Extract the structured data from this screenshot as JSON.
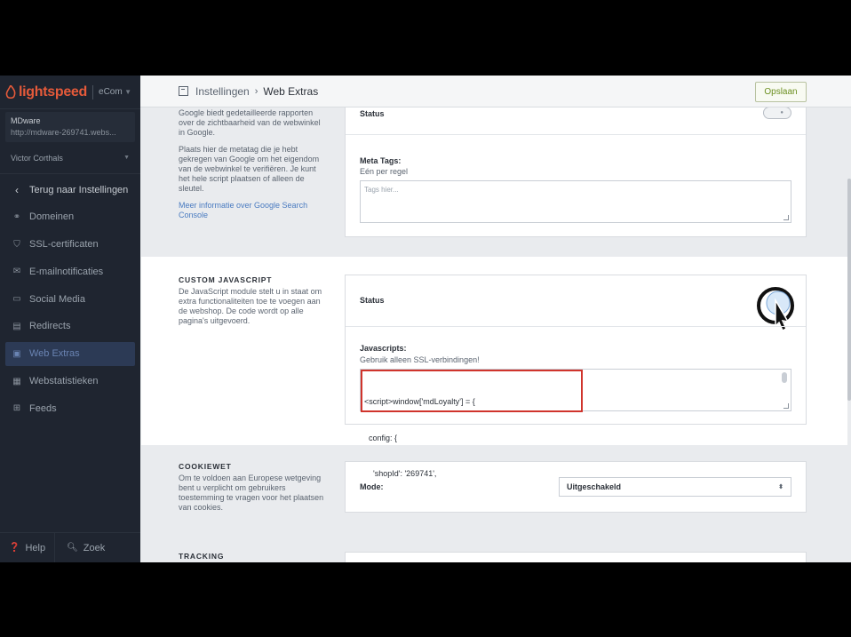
{
  "sidebar": {
    "logo_text": "lightspeed",
    "logo_product": "eCom",
    "store": {
      "name": "MDware",
      "url": "http://mdware-269741.webs..."
    },
    "user": "Victor Corthals",
    "back_label": "Terug naar Instellingen",
    "items": [
      {
        "label": "Domeinen",
        "icon": "link-icon"
      },
      {
        "label": "SSL-certificaten",
        "icon": "shield-icon"
      },
      {
        "label": "E-mailnotificaties",
        "icon": "mail-icon"
      },
      {
        "label": "Social Media",
        "icon": "chat-icon"
      },
      {
        "label": "Redirects",
        "icon": "redirect-icon"
      },
      {
        "label": "Web Extras",
        "icon": "web-extras-icon"
      },
      {
        "label": "Webstatistieken",
        "icon": "stats-icon"
      },
      {
        "label": "Feeds",
        "icon": "feeds-icon"
      }
    ],
    "help_label": "Help",
    "search_label": "Zoek"
  },
  "topbar": {
    "crumb_parent": "Instellingen",
    "crumb_separator": "›",
    "crumb_current": "Web Extras",
    "save_label": "Opslaan"
  },
  "google": {
    "text1": "Google biedt gedetailleerde rapporten over de zichtbaarheid van de webwinkel in Google.",
    "text2": "Plaats hier de metatag die je hebt gekregen van Google om het eigendom van de webwinkel te verifiëren. Je kunt het hele script plaatsen of alleen de sleutel.",
    "link": "Meer informatie over Google Search Console",
    "status_label": "Status",
    "meta_label": "Meta Tags:",
    "meta_sub": "Eén per regel",
    "meta_placeholder": "Tags hier..."
  },
  "custom_js": {
    "heading": "CUSTOM JAVASCRIPT",
    "description": "De JavaScript module stelt u in staat om extra functionaliteiten toe te voegen aan de webshop. De code wordt op alle pagina's uitgevoerd.",
    "status_label": "Status",
    "scripts_label": "Javascripts:",
    "scripts_sub": "Gebruik alleen SSL-verbindingen!",
    "code_lines": [
      "<script>window['mdLoyalty'] = {",
      "  config: {",
      "    'shopId': '269741',"
    ]
  },
  "cookiewet": {
    "heading": "COOKIEWET",
    "description": "Om te voldoen aan Europese wetgeving bent u verplicht om gebruikers toestemming te vragen voor het plaatsen van cookies.",
    "mode_label": "Mode:",
    "mode_value": "Uitgeschakeld"
  },
  "tracking": {
    "heading": "TRACKING"
  },
  "colors": {
    "accent": "#6a84b3",
    "brand": "#e55a3a",
    "highlight_border": "#d0342c",
    "save_text": "#6b8f1f"
  }
}
